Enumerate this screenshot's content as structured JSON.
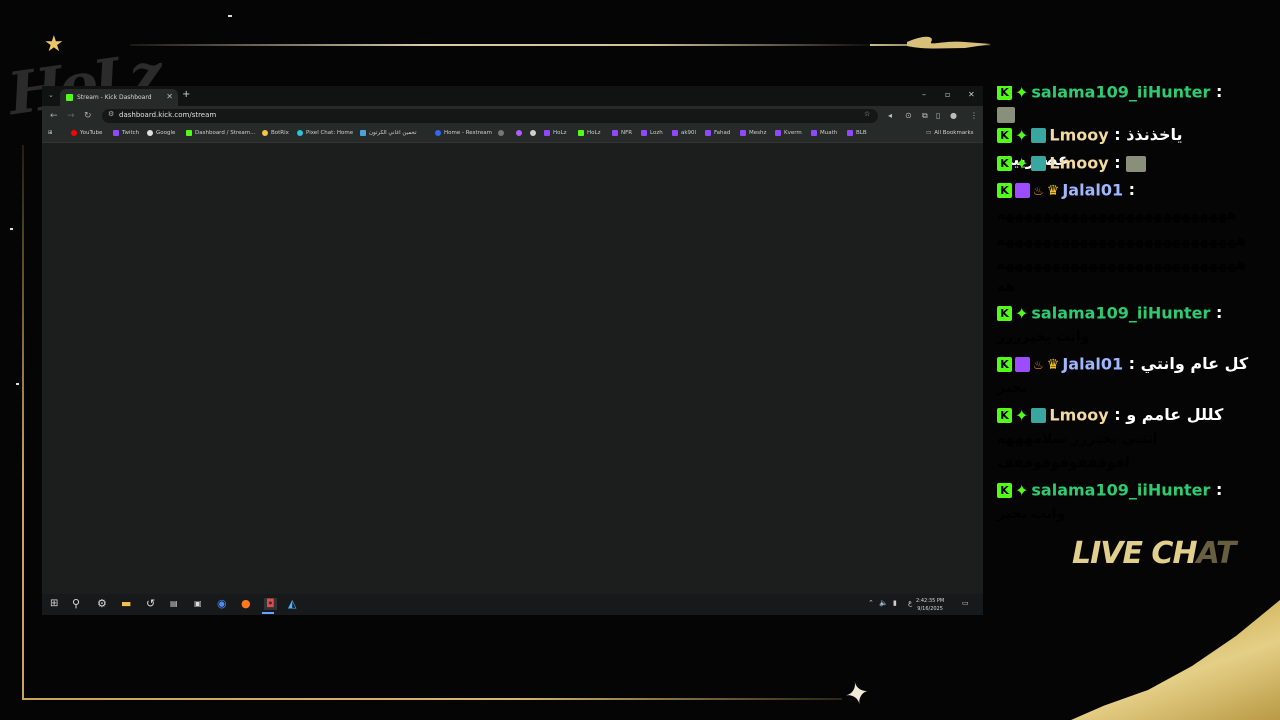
{
  "overlay": {
    "logo_text": "HoLz",
    "live_chat_label_1": "LIVE CH",
    "live_chat_label_2": "AT"
  },
  "browser": {
    "tab_title": "Stream - Kick Dashboard",
    "url": "dashboard.kick.com/stream",
    "bookmarks": [
      {
        "label": "YouTube",
        "color": "#ff0000"
      },
      {
        "label": "Twitch",
        "color": "#9146ff"
      },
      {
        "label": "Google",
        "color": "#4285f4"
      },
      {
        "label": "Dashboard / Stream...",
        "color": "#53fc18"
      },
      {
        "label": "BotRix",
        "color": "#f5c542"
      },
      {
        "label": "Pixel Chat: Home",
        "color": "#29c4d6"
      },
      {
        "label": "تخمين اغاني الكرتون",
        "color": "#4aa3df"
      },
      {
        "label": "Home - Restream",
        "color": "#3467f3"
      },
      {
        "label": "HoLz",
        "color": "#9146ff"
      },
      {
        "label": "HoLz",
        "color": "#53fc18"
      },
      {
        "label": "NFR",
        "color": "#9146ff"
      },
      {
        "label": "Lozh",
        "color": "#9146ff"
      },
      {
        "label": "ak90l",
        "color": "#9146ff"
      },
      {
        "label": "Fahad",
        "color": "#9146ff"
      },
      {
        "label": "Meshz",
        "color": "#9146ff"
      },
      {
        "label": "Kverm",
        "color": "#9146ff"
      },
      {
        "label": "Muath",
        "color": "#9146ff"
      },
      {
        "label": "BLB",
        "color": "#9146ff"
      }
    ],
    "all_bookmarks": "All Bookmarks"
  },
  "taskbar": {
    "time": "2:42:35 PM",
    "date": "9/16/2025",
    "lang": "ع"
  },
  "chat": {
    "messages": [
      {
        "user": "salama109_iiHunter",
        "user_color": "#2ecc71",
        "sep": " :",
        "body": ""
      },
      {
        "user": "Lmooy",
        "user_color": "#f4d9a0",
        "sep": " : ",
        "body": "ياخذنذذ عصيرييي"
      },
      {
        "user": "Lmooy",
        "user_color": "#f4d9a0",
        "sep": " : ",
        "body": ""
      },
      {
        "user": "Jalal01",
        "user_color": "#9fb7ff",
        "sep": " :",
        "body": ""
      },
      {
        "body_only": "هههههههههههههههههههههههههه"
      },
      {
        "body_only": "ههههههههههههههههههههههههههه"
      },
      {
        "body_only": "ههههههههههههههههههههههههههه"
      },
      {
        "body_only": "هه"
      },
      {
        "user": "salama109_iiHunter",
        "user_color": "#2ecc71",
        "sep": " :",
        "body": ""
      },
      {
        "body_only": "وانت بخيرررر"
      },
      {
        "user": "Jalal01",
        "user_color": "#9fb7ff",
        "sep": " : ",
        "body": "كل عام وانتي"
      },
      {
        "body_only": "بخير"
      },
      {
        "user": "Lmooy",
        "user_color": "#f4d9a0",
        "sep": " : ",
        "body": "كللل عامم و"
      },
      {
        "body_only": "انتيي بخيررر سلامهههه"
      },
      {
        "body_only": "افوفففوفوفوففف"
      },
      {
        "user": "salama109_iiHunter",
        "user_color": "#2ecc71",
        "sep": " :",
        "body": ""
      },
      {
        "body_only": "وانت بخير"
      }
    ]
  }
}
